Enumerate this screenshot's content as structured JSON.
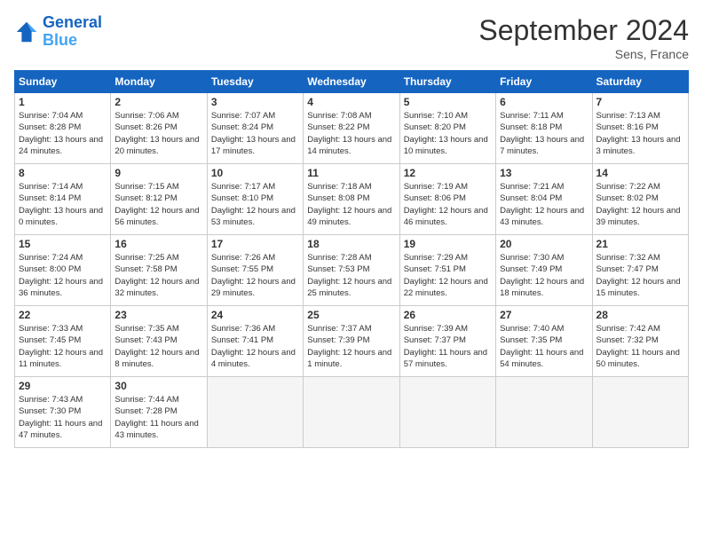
{
  "header": {
    "logo_line1": "General",
    "logo_line2": "Blue",
    "month_title": "September 2024",
    "location": "Sens, France"
  },
  "days_of_week": [
    "Sunday",
    "Monday",
    "Tuesday",
    "Wednesday",
    "Thursday",
    "Friday",
    "Saturday"
  ],
  "weeks": [
    [
      {
        "day": 1,
        "sunrise": "7:04 AM",
        "sunset": "8:28 PM",
        "daylight": "13 hours and 24 minutes."
      },
      {
        "day": 2,
        "sunrise": "7:06 AM",
        "sunset": "8:26 PM",
        "daylight": "13 hours and 20 minutes."
      },
      {
        "day": 3,
        "sunrise": "7:07 AM",
        "sunset": "8:24 PM",
        "daylight": "13 hours and 17 minutes."
      },
      {
        "day": 4,
        "sunrise": "7:08 AM",
        "sunset": "8:22 PM",
        "daylight": "13 hours and 14 minutes."
      },
      {
        "day": 5,
        "sunrise": "7:10 AM",
        "sunset": "8:20 PM",
        "daylight": "13 hours and 10 minutes."
      },
      {
        "day": 6,
        "sunrise": "7:11 AM",
        "sunset": "8:18 PM",
        "daylight": "13 hours and 7 minutes."
      },
      {
        "day": 7,
        "sunrise": "7:13 AM",
        "sunset": "8:16 PM",
        "daylight": "13 hours and 3 minutes."
      }
    ],
    [
      {
        "day": 8,
        "sunrise": "7:14 AM",
        "sunset": "8:14 PM",
        "daylight": "13 hours and 0 minutes."
      },
      {
        "day": 9,
        "sunrise": "7:15 AM",
        "sunset": "8:12 PM",
        "daylight": "12 hours and 56 minutes."
      },
      {
        "day": 10,
        "sunrise": "7:17 AM",
        "sunset": "8:10 PM",
        "daylight": "12 hours and 53 minutes."
      },
      {
        "day": 11,
        "sunrise": "7:18 AM",
        "sunset": "8:08 PM",
        "daylight": "12 hours and 49 minutes."
      },
      {
        "day": 12,
        "sunrise": "7:19 AM",
        "sunset": "8:06 PM",
        "daylight": "12 hours and 46 minutes."
      },
      {
        "day": 13,
        "sunrise": "7:21 AM",
        "sunset": "8:04 PM",
        "daylight": "12 hours and 43 minutes."
      },
      {
        "day": 14,
        "sunrise": "7:22 AM",
        "sunset": "8:02 PM",
        "daylight": "12 hours and 39 minutes."
      }
    ],
    [
      {
        "day": 15,
        "sunrise": "7:24 AM",
        "sunset": "8:00 PM",
        "daylight": "12 hours and 36 minutes."
      },
      {
        "day": 16,
        "sunrise": "7:25 AM",
        "sunset": "7:58 PM",
        "daylight": "12 hours and 32 minutes."
      },
      {
        "day": 17,
        "sunrise": "7:26 AM",
        "sunset": "7:55 PM",
        "daylight": "12 hours and 29 minutes."
      },
      {
        "day": 18,
        "sunrise": "7:28 AM",
        "sunset": "7:53 PM",
        "daylight": "12 hours and 25 minutes."
      },
      {
        "day": 19,
        "sunrise": "7:29 AM",
        "sunset": "7:51 PM",
        "daylight": "12 hours and 22 minutes."
      },
      {
        "day": 20,
        "sunrise": "7:30 AM",
        "sunset": "7:49 PM",
        "daylight": "12 hours and 18 minutes."
      },
      {
        "day": 21,
        "sunrise": "7:32 AM",
        "sunset": "7:47 PM",
        "daylight": "12 hours and 15 minutes."
      }
    ],
    [
      {
        "day": 22,
        "sunrise": "7:33 AM",
        "sunset": "7:45 PM",
        "daylight": "12 hours and 11 minutes."
      },
      {
        "day": 23,
        "sunrise": "7:35 AM",
        "sunset": "7:43 PM",
        "daylight": "12 hours and 8 minutes."
      },
      {
        "day": 24,
        "sunrise": "7:36 AM",
        "sunset": "7:41 PM",
        "daylight": "12 hours and 4 minutes."
      },
      {
        "day": 25,
        "sunrise": "7:37 AM",
        "sunset": "7:39 PM",
        "daylight": "12 hours and 1 minute."
      },
      {
        "day": 26,
        "sunrise": "7:39 AM",
        "sunset": "7:37 PM",
        "daylight": "11 hours and 57 minutes."
      },
      {
        "day": 27,
        "sunrise": "7:40 AM",
        "sunset": "7:35 PM",
        "daylight": "11 hours and 54 minutes."
      },
      {
        "day": 28,
        "sunrise": "7:42 AM",
        "sunset": "7:32 PM",
        "daylight": "11 hours and 50 minutes."
      }
    ],
    [
      {
        "day": 29,
        "sunrise": "7:43 AM",
        "sunset": "7:30 PM",
        "daylight": "11 hours and 47 minutes."
      },
      {
        "day": 30,
        "sunrise": "7:44 AM",
        "sunset": "7:28 PM",
        "daylight": "11 hours and 43 minutes."
      },
      null,
      null,
      null,
      null,
      null
    ]
  ]
}
